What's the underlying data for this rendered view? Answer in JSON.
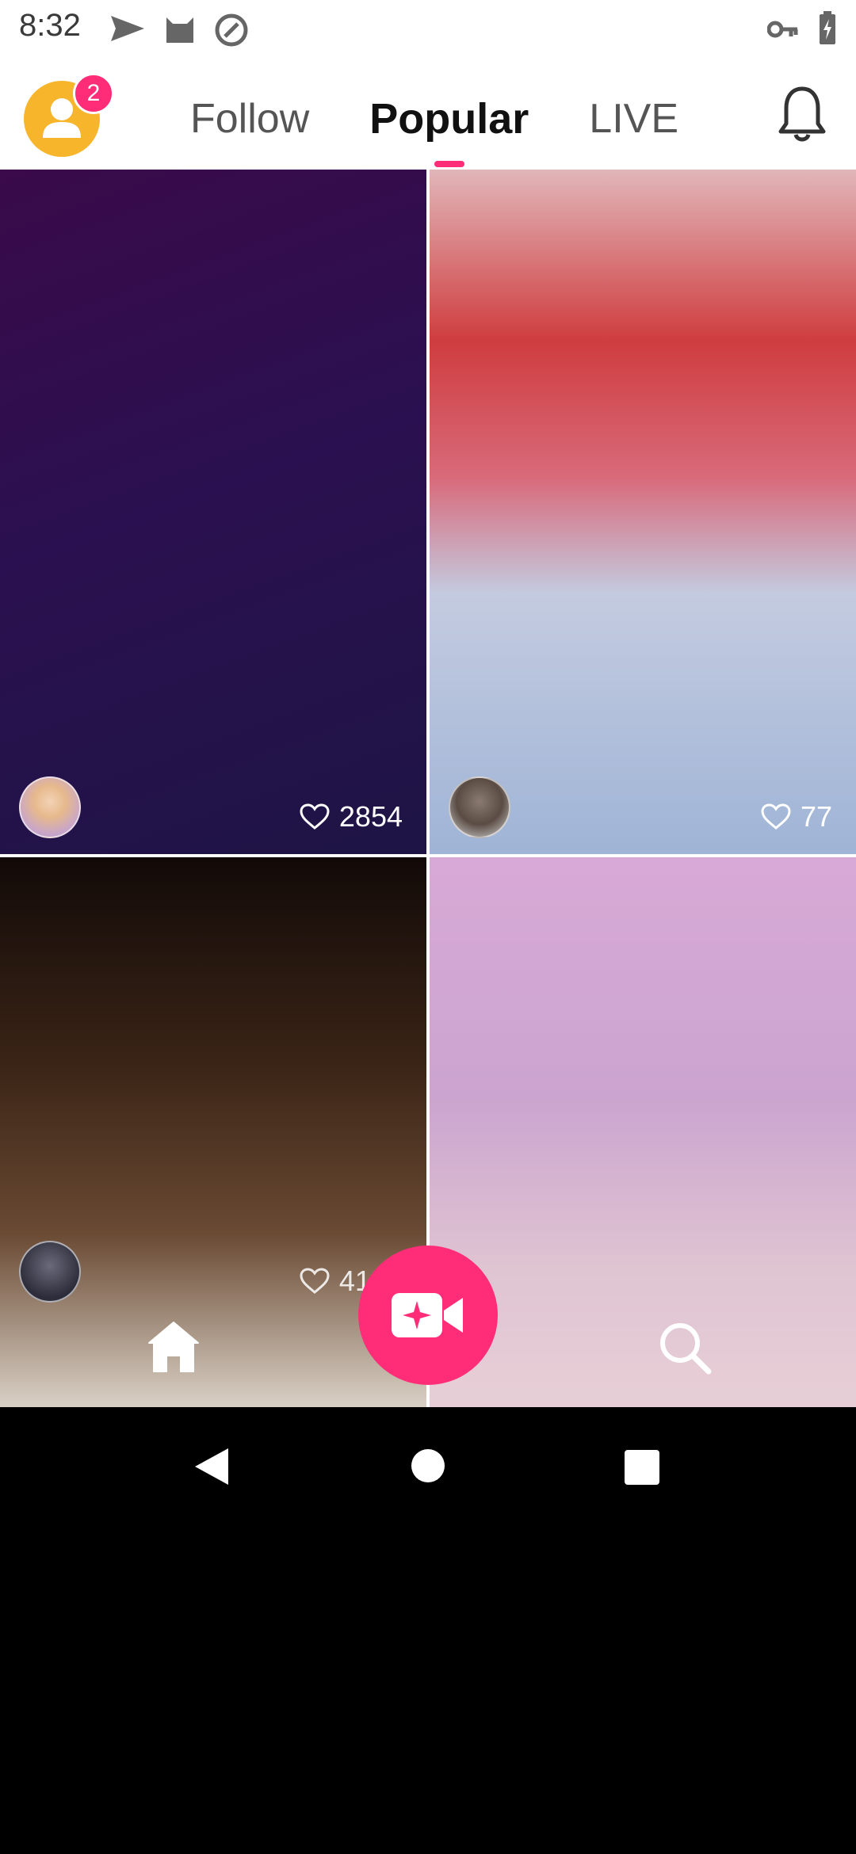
{
  "status_bar": {
    "time": "8:32",
    "icons": [
      "send-icon",
      "cat-icon",
      "at-sign-icon",
      "key-icon",
      "battery-charging-icon"
    ]
  },
  "header": {
    "profile_badge": "2",
    "tabs": [
      {
        "label": "Follow",
        "active": false
      },
      {
        "label": "Popular",
        "active": true
      },
      {
        "label": "LIVE",
        "active": false
      }
    ],
    "accent_color": "#ff2d78"
  },
  "feed": {
    "items": [
      {
        "likes": "2854"
      },
      {
        "likes": "77"
      },
      {
        "likes": "4192"
      },
      {
        "likes": ""
      }
    ]
  },
  "bottom_nav": {
    "items": [
      "home-icon",
      "record-video-icon",
      "search-icon"
    ]
  },
  "system_nav": {
    "items": [
      "back-icon",
      "home-circle-icon",
      "recents-icon"
    ]
  }
}
